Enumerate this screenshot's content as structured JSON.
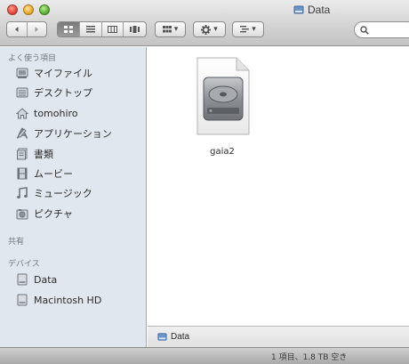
{
  "window": {
    "title": "Data"
  },
  "toolbar": {
    "back_icon": "chevron-left-icon",
    "forward_icon": "chevron-right-icon",
    "view_modes": [
      "icon-view",
      "list-view",
      "column-view",
      "cover-flow-view"
    ],
    "active_view": "icon-view",
    "arrange_icon": "grid-icon",
    "action_icon": "gear-icon",
    "share_icon": "list-icon",
    "search_placeholder": ""
  },
  "sidebar": {
    "favorites_header": "よく使う項目",
    "favorites": [
      {
        "label": "マイファイル",
        "icon": "all-my-files-icon"
      },
      {
        "label": "デスクトップ",
        "icon": "desktop-icon"
      },
      {
        "label": "tomohiro",
        "icon": "home-icon"
      },
      {
        "label": "アプリケーション",
        "icon": "applications-icon"
      },
      {
        "label": "書類",
        "icon": "documents-icon"
      },
      {
        "label": "ムービー",
        "icon": "movies-icon"
      },
      {
        "label": "ミュージック",
        "icon": "music-icon"
      },
      {
        "label": "ピクチャ",
        "icon": "pictures-icon"
      }
    ],
    "shared_header": "共有",
    "devices_header": "デバイス",
    "devices": [
      {
        "label": "Data",
        "icon": "drive-icon"
      },
      {
        "label": "Macintosh HD",
        "icon": "drive-icon"
      }
    ]
  },
  "content": {
    "files": [
      {
        "name": "gaia2",
        "icon": "disk-image-icon"
      }
    ]
  },
  "pathbar": {
    "label": "Data"
  },
  "statusbar": {
    "text": "1 項目、1.8 TB 空き"
  }
}
